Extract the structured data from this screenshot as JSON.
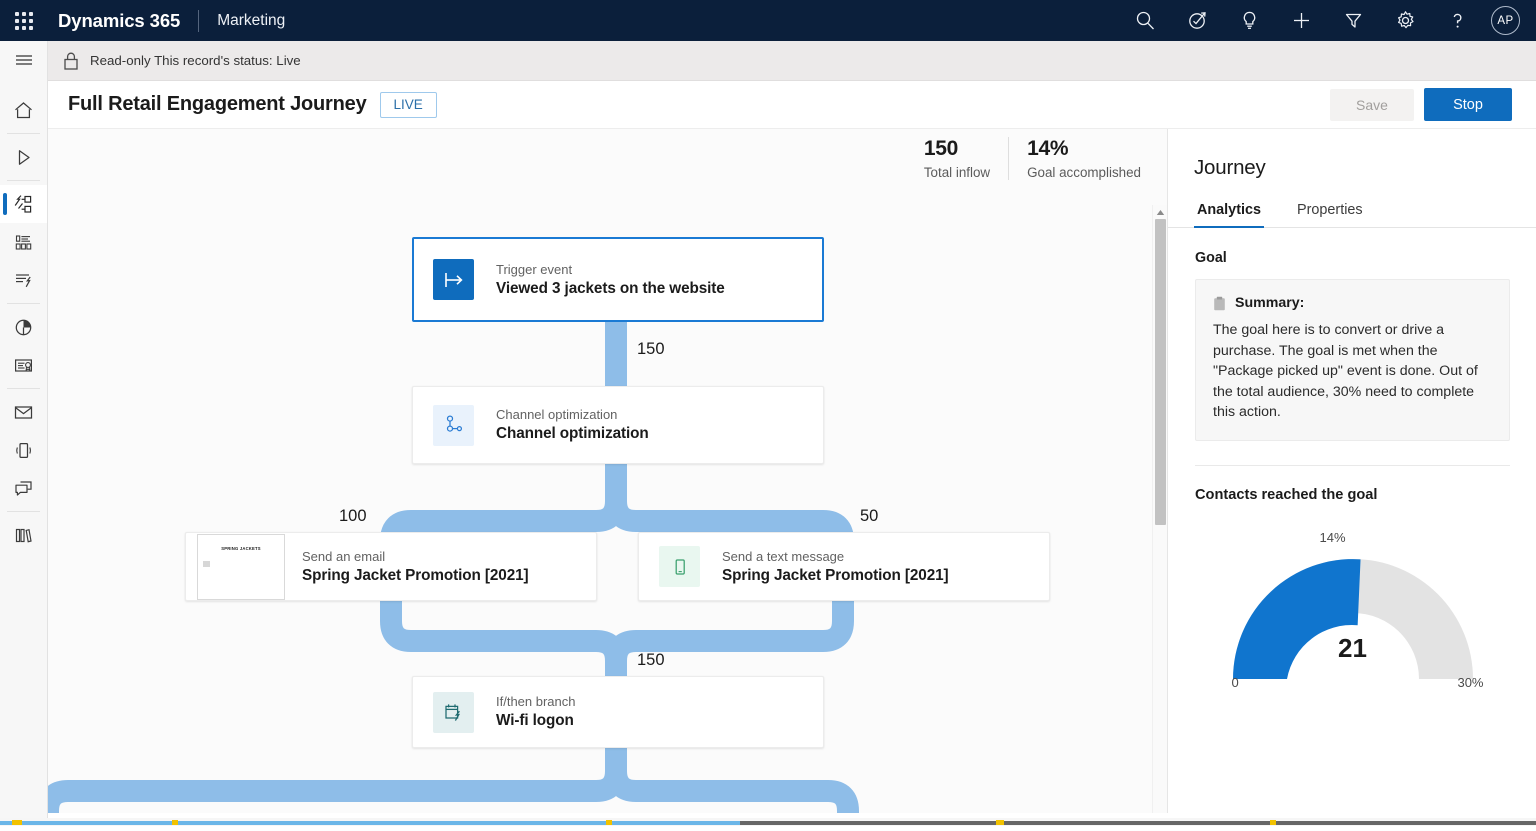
{
  "topnav": {
    "waffle": "app-launcher",
    "brand": "Dynamics 365",
    "app": "Marketing",
    "icons": [
      "search-icon",
      "assistant-icon",
      "idea-icon",
      "add-icon",
      "filter-icon",
      "settings-icon",
      "help-icon"
    ],
    "avatar_initials": "AP"
  },
  "rail": {
    "items": [
      {
        "name": "hamburger-menu",
        "icon": "hamburger-icon"
      },
      {
        "name": "home",
        "icon": "home-icon"
      },
      {
        "name": "recent",
        "icon": "play-icon"
      },
      {
        "name": "customer-journeys",
        "icon": "journey-icon",
        "active": true
      },
      {
        "name": "segments",
        "icon": "segments-icon"
      },
      {
        "name": "triggers",
        "icon": "trigger-lightning-icon"
      },
      {
        "name": "analytics",
        "icon": "pie-chart-icon"
      },
      {
        "name": "certificates",
        "icon": "certificate-icon"
      },
      {
        "name": "emails",
        "icon": "envelope-icon"
      },
      {
        "name": "text-messages",
        "icon": "mobile-icon"
      },
      {
        "name": "push-notifications",
        "icon": "chat-icon"
      },
      {
        "name": "library",
        "icon": "library-icon"
      }
    ]
  },
  "readonly": {
    "icon": "lock-icon",
    "text": "Read-only This record's status: Live"
  },
  "command_bar": {
    "record_title": "Full Retail Engagement Journey",
    "status_badge": "LIVE",
    "save_label": "Save",
    "stop_label": "Stop"
  },
  "stats": [
    {
      "value": "150",
      "label": "Total inflow"
    },
    {
      "value": "14%",
      "label": "Goal accomplished"
    }
  ],
  "flow": {
    "nodes": [
      {
        "id": "trigger",
        "icon": "trigger-arrow-icon",
        "kicker": "Trigger event",
        "title": "Viewed 3 jackets on the website",
        "selected": true
      },
      {
        "id": "channel",
        "icon": "channel-optimization-icon",
        "kicker": "Channel optimization",
        "title": "Channel optimization",
        "selected": false
      },
      {
        "id": "email",
        "icon": "email-thumbnail",
        "kicker": "Send an email",
        "title": "Spring Jacket Promotion [2021]",
        "thumb_text": "SPRING JACKETS",
        "selected": false
      },
      {
        "id": "sms",
        "icon": "mobile-message-icon",
        "kicker": "Send a text message",
        "title": "Spring Jacket Promotion [2021]",
        "selected": false
      },
      {
        "id": "branch",
        "icon": "if-then-branch-icon",
        "kicker": "If/then branch",
        "title": "Wi-fi logon",
        "selected": false
      }
    ],
    "edge_labels": [
      {
        "id": "e1",
        "value": "150"
      },
      {
        "id": "e2",
        "value": "100"
      },
      {
        "id": "e3",
        "value": "50"
      },
      {
        "id": "e4",
        "value": "150"
      }
    ],
    "connector_color": "#8ebde8"
  },
  "panel": {
    "title": "Journey",
    "tabs": [
      {
        "label": "Analytics",
        "active": true
      },
      {
        "label": "Properties",
        "active": false
      }
    ],
    "goal_heading": "Goal",
    "summary_icon": "clipboard-icon",
    "summary_label": "Summary:",
    "summary_text": "The goal here is to convert or drive a purchase. The goal is met when the \"Package picked up\" event is done. Out of the total audience, 30% need to complete this action."
  },
  "chart_data": {
    "type": "pie",
    "title": "Contacts reached the goal",
    "subtype": "half-donut-gauge",
    "value": 14,
    "value_label": "14%",
    "center_value": "21",
    "min": 0,
    "min_label": "0",
    "max": 30,
    "max_label": "30%",
    "unit": "%",
    "categories": [
      "Reached goal",
      "Remaining"
    ],
    "values": [
      14,
      16
    ],
    "colors": [
      "#1075ce",
      "#e3e3e3"
    ],
    "xlabel": "",
    "ylabel": "",
    "grid": false,
    "legend": "none"
  },
  "colors": {
    "nav_bg": "#0b1f3b",
    "accent": "#0f6cbd",
    "connector": "#8ebde8",
    "gauge_fill": "#1075ce",
    "gauge_track": "#e3e3e3"
  }
}
